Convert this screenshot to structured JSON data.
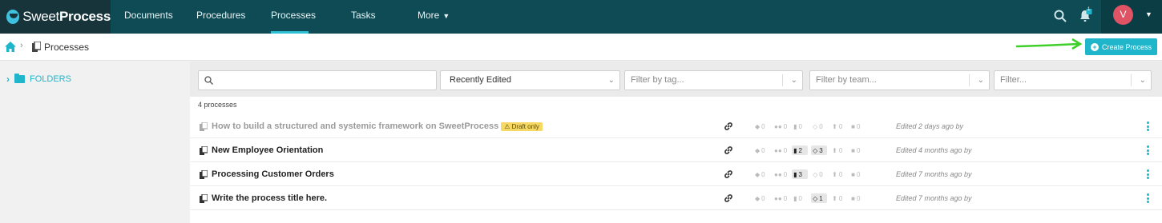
{
  "brand": {
    "name_light": "Sweet",
    "name_bold": "Process"
  },
  "nav": {
    "items": [
      "Documents",
      "Procedures",
      "Processes",
      "Tasks",
      "More"
    ],
    "active": "Processes"
  },
  "user": {
    "initial": "V"
  },
  "notifications": {
    "count": "1"
  },
  "breadcrumb": {
    "label": "Processes"
  },
  "create_button": {
    "label": "Create Process"
  },
  "sidebar": {
    "folders_label": "FOLDERS"
  },
  "filters": {
    "search_placeholder": "",
    "sort_value": "Recently Edited",
    "tag_placeholder": "Filter by tag...",
    "team_placeholder": "Filter by team...",
    "other_placeholder": "Filter..."
  },
  "list": {
    "count_label": "4 processes",
    "rows": [
      {
        "title": "How to build a structured and systemic framework on SweetProcess",
        "draft_label": "Draft only",
        "stats": [
          "0",
          "0",
          "0",
          "0",
          "0",
          "0"
        ],
        "edited": "Edited 2 days ago by"
      },
      {
        "title": "New Employee Orientation",
        "stats": [
          "0",
          "0",
          "2",
          "3",
          "0",
          "0"
        ],
        "edited": "Edited 4 months ago by"
      },
      {
        "title": "Processing Customer Orders",
        "stats": [
          "0",
          "0",
          "3",
          "0",
          "0",
          "0"
        ],
        "edited": "Edited 7 months ago by"
      },
      {
        "title": "Write the process title here.",
        "stats": [
          "0",
          "0",
          "0",
          "1",
          "0",
          "0"
        ],
        "edited": "Edited 7 months ago by"
      }
    ]
  },
  "colors": {
    "topbar": "#0f4b55",
    "accent": "#1fb6cc",
    "draft": "#f6d865",
    "arrow": "#3fcf2a"
  }
}
